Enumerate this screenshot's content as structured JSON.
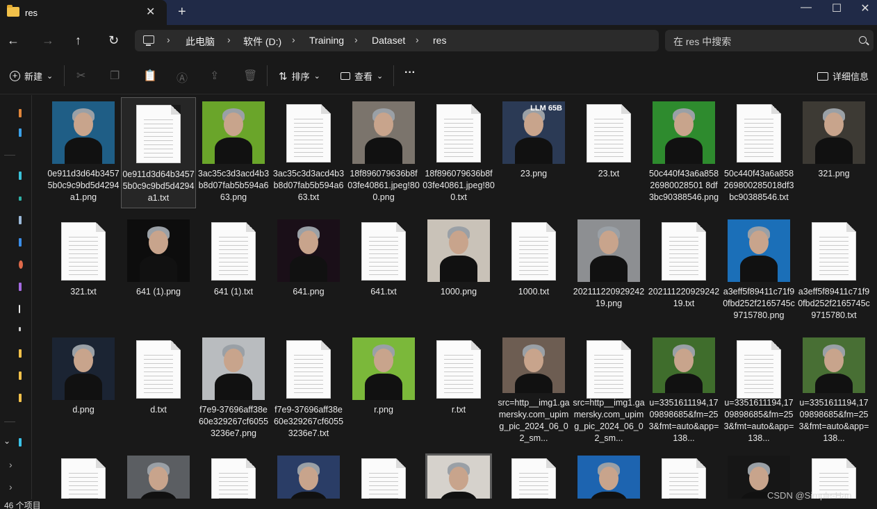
{
  "window": {
    "tab_title": "res",
    "close_tab": "✕",
    "new_tab": "+",
    "minimize": "—",
    "maximize": "☐",
    "close": "✕"
  },
  "nav": {
    "back": "←",
    "forward": "→",
    "up": "↑",
    "refresh": "↻",
    "breadcrumb": [
      "此电脑",
      "软件 (D:)",
      "Training",
      "Dataset",
      "res"
    ],
    "separator": "›",
    "search_placeholder": "在 res 中搜索"
  },
  "toolbar": {
    "new_label": "新建",
    "sort_label": "排序",
    "view_label": "查看",
    "more": "···",
    "details_label": "详细信息",
    "chevron": "⌄",
    "icons": [
      "cut-icon",
      "copy-icon",
      "paste-icon",
      "rename-icon",
      "share-icon",
      "delete-icon"
    ]
  },
  "files": [
    {
      "name": "0e911d3d64b34575b0c9c9bd5d4294a1.png",
      "type": "image",
      "bg": "#1f5e86"
    },
    {
      "name": "0e911d3d64b34575b0c9c9bd5d4294a1.txt",
      "type": "text",
      "selected": true
    },
    {
      "name": "3ac35c3d3acd4b3b8d07fab5b594a663.png",
      "type": "image",
      "bg": "#6aa52a"
    },
    {
      "name": "3ac35c3d3acd4b3b8d07fab5b594a663.txt",
      "type": "text"
    },
    {
      "name": "18f896079636b8f03fe40861.jpeg!800.png",
      "type": "image",
      "bg": "#7b746c"
    },
    {
      "name": "18f896079636b8f03fe40861.jpeg!800.txt",
      "type": "text"
    },
    {
      "name": "23.png",
      "type": "image",
      "bg": "#2b3a55",
      "badge": "LLM 65B"
    },
    {
      "name": "23.txt",
      "type": "text"
    },
    {
      "name": "50c440f43a6a85826980028501 8df3bc90388546.png",
      "type": "image",
      "bg": "#2e8b2e"
    },
    {
      "name": "50c440f43a6a858269800285018df3bc90388546.txt",
      "type": "text"
    },
    {
      "name": "321.png",
      "type": "image",
      "bg": "#3d3a34"
    },
    {
      "name": "321.txt",
      "type": "text"
    },
    {
      "name": "641 (1).png",
      "type": "image",
      "bg": "#0d0d0d"
    },
    {
      "name": "641 (1).txt",
      "type": "text"
    },
    {
      "name": "641.png",
      "type": "image",
      "bg": "#1a0f18"
    },
    {
      "name": "641.txt",
      "type": "text"
    },
    {
      "name": "1000.png",
      "type": "image",
      "bg": "#c9c2b8"
    },
    {
      "name": "1000.txt",
      "type": "text"
    },
    {
      "name": "20211122092924219.png",
      "type": "image",
      "bg": "#8d8f92"
    },
    {
      "name": "20211122092924219.txt",
      "type": "text"
    },
    {
      "name": "a3eff5f89411c71f90fbd252f2165745c9715780.png",
      "type": "image",
      "bg": "#1b6fb8"
    },
    {
      "name": "a3eff5f89411c71f90fbd252f2165745c9715780.txt",
      "type": "text"
    },
    {
      "name": "d.png",
      "type": "image",
      "bg": "#1b2433"
    },
    {
      "name": "d.txt",
      "type": "text"
    },
    {
      "name": "f7e9-37696aff38e60e329267cf60553236e7.png",
      "type": "image",
      "bg": "#b9bcbf"
    },
    {
      "name": "f7e9-37696aff38e60e329267cf60553236e7.txt",
      "type": "text"
    },
    {
      "name": "r.png",
      "type": "image",
      "bg": "#7bb83a"
    },
    {
      "name": "r.txt",
      "type": "text"
    },
    {
      "name": "src=http__img1.gamersky.com_upimg_pic_2024_06_02_sm...",
      "type": "image",
      "bg": "#6d5d52"
    },
    {
      "name": "src=http__img1.gamersky.com_upimg_pic_2024_06_02_sm...",
      "type": "text"
    },
    {
      "name": "u=3351611194,1709898685&fm=253&fmt=auto&app=138...",
      "type": "image",
      "bg": "#3f6d2c"
    },
    {
      "name": "u=3351611194,1709898685&fm=253&fmt=auto&app=138...",
      "type": "text"
    },
    {
      "name": "u=3351611194,1709898685&fm=253&fmt=auto&app=138...",
      "type": "image",
      "bg": "#486f34"
    },
    {
      "name": "",
      "type": "text"
    },
    {
      "name": "",
      "type": "image",
      "bg": "#5b5e62"
    },
    {
      "name": "",
      "type": "text"
    },
    {
      "name": "",
      "type": "image",
      "bg": "#2a3d66"
    },
    {
      "name": "",
      "type": "text"
    },
    {
      "name": "",
      "type": "image",
      "bg": "#d6d2cc",
      "selected": true
    },
    {
      "name": "",
      "type": "text"
    },
    {
      "name": "",
      "type": "image",
      "bg": "#1d64b0"
    },
    {
      "name": "",
      "type": "text"
    },
    {
      "name": "",
      "type": "image",
      "bg": "#161616"
    },
    {
      "name": "",
      "type": "text"
    }
  ],
  "status": {
    "count": "46 个项目"
  },
  "watermark": "CSDN @Simple-Han"
}
